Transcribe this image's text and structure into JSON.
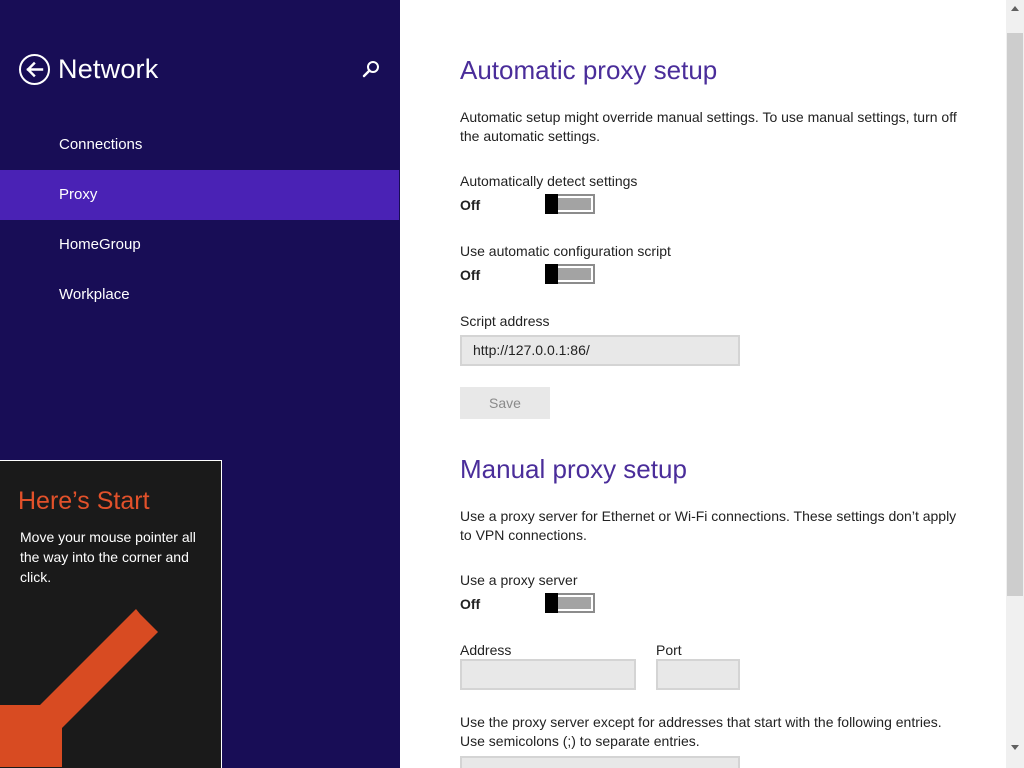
{
  "nav": {
    "title": "Network",
    "items": [
      {
        "label": "Connections",
        "selected": false
      },
      {
        "label": "Proxy",
        "selected": true
      },
      {
        "label": "HomeGroup",
        "selected": false
      },
      {
        "label": "Workplace",
        "selected": false
      }
    ],
    "colors": {
      "background": "#180d56",
      "selected": "#4a22b5"
    }
  },
  "start_tip": {
    "title": "Here’s Start",
    "body": "Move your mouse pointer all the way into the corner and click.",
    "colors": {
      "title": "#e2512a",
      "arrow": "#d84b22"
    }
  },
  "auto_proxy": {
    "heading": "Automatic proxy setup",
    "description": "Automatic setup might override manual settings. To use manual settings, turn off the automatic settings.",
    "detect_label": "Automatically detect settings",
    "detect_state": "Off",
    "script_toggle_label": "Use automatic configuration script",
    "script_toggle_state": "Off",
    "script_address_label": "Script address",
    "script_address_value": "http://127.0.0.1:86/",
    "save_label": "Save"
  },
  "manual_proxy": {
    "heading": "Manual proxy setup",
    "description": "Use a proxy server for Ethernet or Wi-Fi connections. These settings don’t apply to VPN connections.",
    "use_proxy_label": "Use a proxy server",
    "use_proxy_state": "Off",
    "address_label": "Address",
    "address_value": "",
    "port_label": "Port",
    "port_value": "",
    "exceptions_description": "Use the proxy server except for addresses that start with the following entries. Use semicolons (;) to separate entries."
  },
  "accent_color": "#4a2d9a"
}
